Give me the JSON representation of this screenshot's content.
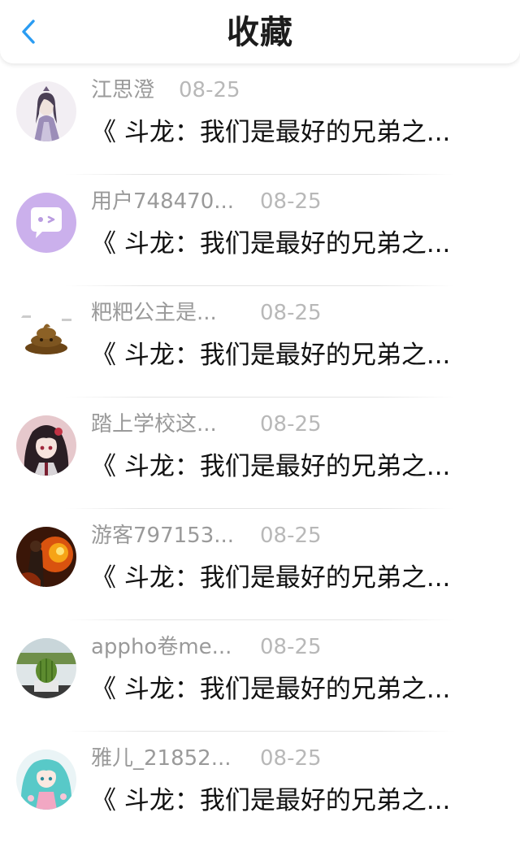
{
  "header": {
    "title": "收藏",
    "back_icon": "chevron-left-icon",
    "accent_color": "#2a9cf2"
  },
  "items": [
    {
      "name": "江思澄",
      "date": "08-25",
      "title": "《 斗龙：我们是最好的兄弟之...",
      "avatar": "avatar-anime-purple"
    },
    {
      "name": "用户748470...",
      "date": "08-25",
      "title": "《 斗龙：我们是最好的兄弟之...",
      "avatar": "avatar-chat-bubble-purple"
    },
    {
      "name": "粑粑公主是...",
      "date": "08-25",
      "title": "《 斗龙：我们是最好的兄弟之...",
      "avatar": "avatar-poop"
    },
    {
      "name": "踏上学校这...",
      "date": "08-25",
      "title": "《 斗龙：我们是最好的兄弟之...",
      "avatar": "avatar-anime-girl-red"
    },
    {
      "name": "游客797153...",
      "date": "08-25",
      "title": "《 斗龙：我们是最好的兄弟之...",
      "avatar": "avatar-fire"
    },
    {
      "name": "appho卷me...",
      "date": "08-25",
      "title": "《 斗龙：我们是最好的兄弟之...",
      "avatar": "avatar-cactus"
    },
    {
      "name": "雅儿_21852...",
      "date": "08-25",
      "title": "《 斗龙：我们是最好的兄弟之...",
      "avatar": "avatar-anime-teal"
    }
  ]
}
